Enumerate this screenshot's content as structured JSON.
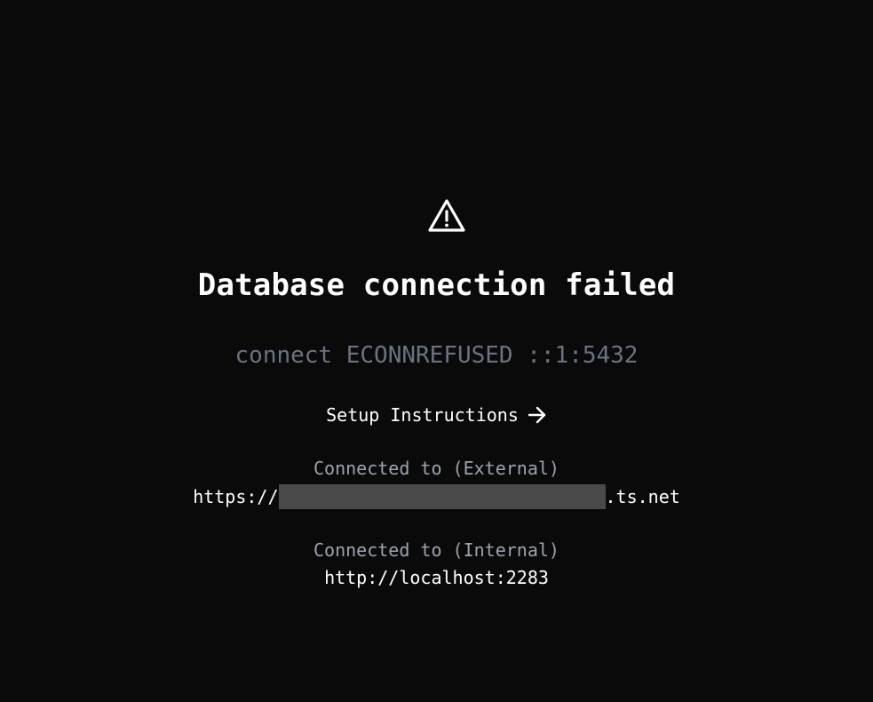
{
  "error": {
    "title": "Database connection failed",
    "message": "connect ECONNREFUSED ::1:5432",
    "icon": "warning-triangle-icon"
  },
  "setup": {
    "label": "Setup Instructions",
    "icon": "arrow-right-icon"
  },
  "connections": {
    "external": {
      "label": "Connected to (External)",
      "url_prefix": "https://",
      "url_suffix": ".ts.net"
    },
    "internal": {
      "label": "Connected to (Internal)",
      "url": "http://localhost:2283"
    }
  },
  "colors": {
    "background": "#0a0a0a",
    "muted_text": "#6b7280",
    "label_text": "#9ca3af",
    "redaction": "#4a4a4a"
  }
}
